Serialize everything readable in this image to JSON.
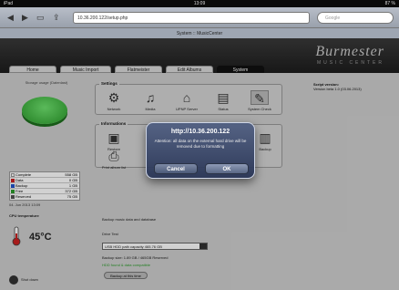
{
  "status_bar": {
    "carrier": "iPad",
    "time": "13:09",
    "battery": "87 %"
  },
  "browser": {
    "url": "10.36.200.122/setup.php",
    "search_placeholder": "Google",
    "page_title": "System :: MusicCenter"
  },
  "brand": {
    "name": "Burmester",
    "tagline": "MUSIC CENTER"
  },
  "tabs": [
    {
      "label": "Home"
    },
    {
      "label": "Music Import"
    },
    {
      "label": "Flatmeister"
    },
    {
      "label": "Edit Albums"
    },
    {
      "label": "System"
    }
  ],
  "sidebar": {
    "storage_label": "Storage usage (Datenlast)",
    "legend": [
      {
        "label": "Complete",
        "value": "558 GB",
        "color": "#ffffff"
      },
      {
        "label": "Data",
        "value": "0 GB",
        "color": "#cc2222"
      },
      {
        "label": "Backup",
        "value": "1 GB",
        "color": "#2255cc"
      },
      {
        "label": "Free",
        "value": "372 GB",
        "color": "#2c9c2c"
      },
      {
        "label": "Reserved",
        "value": "75 GB",
        "color": "#555555"
      }
    ],
    "date": "04. Jun 2013 13:09",
    "cpu_label": "CPU temperature",
    "cpu_temp": "45°C",
    "shutdown_label": "Shut down"
  },
  "settings": {
    "title": "Settings",
    "items": [
      {
        "label": "Network",
        "icon": "network-icon",
        "glyph": "⚙"
      },
      {
        "label": "Media",
        "icon": "media-icon",
        "glyph": "♫"
      },
      {
        "label": "UPNP Server",
        "icon": "upnp-server-icon",
        "glyph": "⌂"
      },
      {
        "label": "Status",
        "icon": "status-icon",
        "glyph": "▤"
      },
      {
        "label": "System Check",
        "icon": "system-check-icon",
        "glyph": "✎"
      }
    ],
    "script_version_label": "Script version:",
    "script_version_value": "Version beta 1.0 (03.06.2013)"
  },
  "informations": {
    "title": "Informations",
    "items": [
      {
        "label": "Restore",
        "icon": "restore-icon",
        "glyph": "▣"
      },
      {
        "label": "Print album list",
        "icon": "print-icon",
        "glyph": "⎙"
      },
      {
        "label": "Backup",
        "icon": "backup-icon",
        "glyph": "▥"
      }
    ]
  },
  "backup": {
    "heading": "Backup music data and database",
    "drive_label": "Drive Test",
    "drive_value": "USB HDD path capacity 465.76 GB",
    "info_line": "Backup size: 1.89 GB / 465GB Reserved",
    "ok_message": "HDD found & data compatible",
    "start_button": "Backup at this time"
  },
  "alert": {
    "title": "http://10.36.200.122",
    "message": "Attention: all data on the external hard drive will be removed due to formatting",
    "cancel": "Cancel",
    "ok": "OK"
  }
}
